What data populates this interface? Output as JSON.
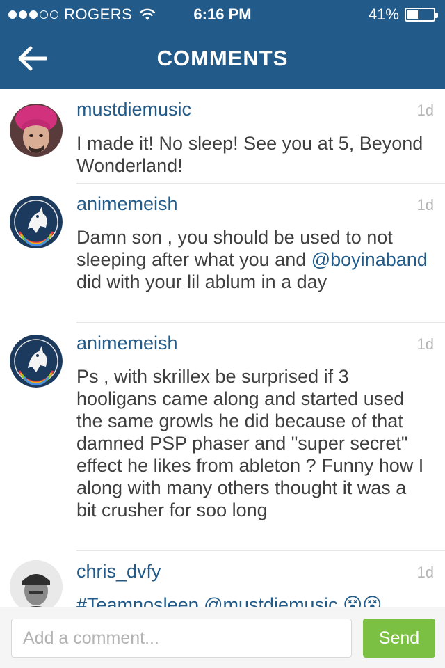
{
  "status_bar": {
    "signal_filled": 3,
    "signal_total": 5,
    "carrier": "ROGERS",
    "time": "6:16 PM",
    "battery_percent_text": "41%",
    "battery_level": 0.41
  },
  "nav": {
    "title": "COMMENTS",
    "back_icon": "back-arrow-icon"
  },
  "comments": [
    {
      "username": "mustdiemusic",
      "age": "1d",
      "text": "I made it! No sleep! See you at 5, Beyond Wonderland!"
    },
    {
      "username": "animemeish",
      "age": "1d",
      "text_before": "Damn son , you should be used to not sleeping after what you and ",
      "mention": "@boyinaband",
      "text_after": " did with your lil ablum in a day"
    },
    {
      "username": "animemeish",
      "age": "1d",
      "text": "Ps , with skrillex be surprised if 3 hooligans came along and started used the same growls he did because of that damned PSP phaser and \"super secret\" effect he likes from ableton ? Funny how I along with many others thought it was a bit crusher for soo long"
    },
    {
      "username": "chris_dvfy",
      "age": "1d",
      "tags": "#Teamnosleep @mustdiemusic",
      "emoji": "😵😵"
    }
  ],
  "footer": {
    "input_placeholder": "Add a comment...",
    "send_label": "Send"
  },
  "colors": {
    "header_bg": "#225b89",
    "accent": "#225b89",
    "send_bg": "#7bc043"
  }
}
